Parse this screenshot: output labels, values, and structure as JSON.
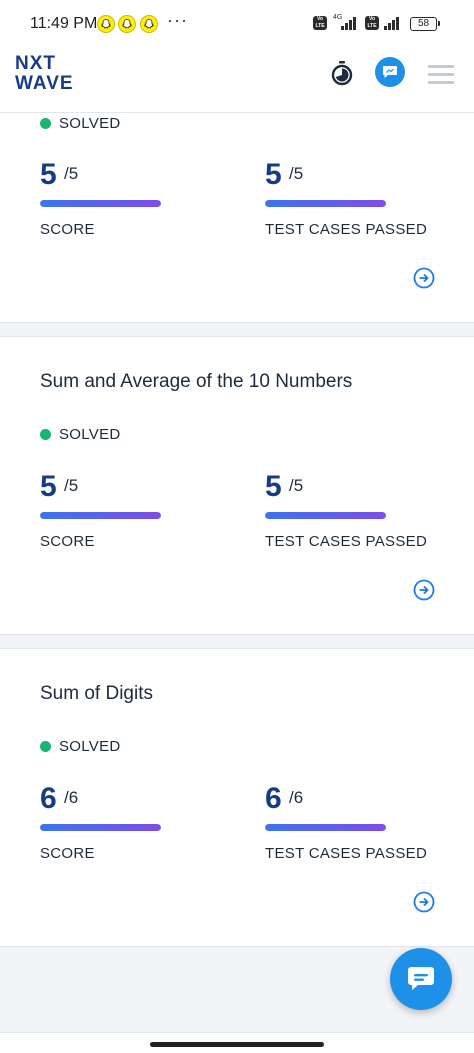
{
  "status_bar": {
    "time": "11:49 PM",
    "more": "···",
    "network": "4G",
    "volte": "Vo LTE",
    "battery": "58"
  },
  "header": {
    "logo_top": "NXT",
    "logo_bottom": "WAVE",
    "icons": [
      "timer-icon",
      "chat-icon",
      "menu-icon"
    ]
  },
  "cards": [
    {
      "title": "",
      "status": "SOLVED",
      "score": {
        "value": "5",
        "total": "/5",
        "label": "SCORE",
        "fraction": 1.0
      },
      "tests": {
        "value": "5",
        "total": "/5",
        "label": "TEST CASES PASSED",
        "fraction": 1.0
      }
    },
    {
      "title": "Sum and Average of the 10 Numbers",
      "status": "SOLVED",
      "score": {
        "value": "5",
        "total": "/5",
        "label": "SCORE",
        "fraction": 1.0
      },
      "tests": {
        "value": "5",
        "total": "/5",
        "label": "TEST CASES PASSED",
        "fraction": 1.0
      }
    },
    {
      "title": "Sum of Digits",
      "status": "SOLVED",
      "score": {
        "value": "6",
        "total": "/6",
        "label": "SCORE",
        "fraction": 1.0
      },
      "tests": {
        "value": "6",
        "total": "/6",
        "label": "TEST CASES PASSED",
        "fraction": 1.0
      }
    }
  ],
  "colors": {
    "brand": "#183b88",
    "accent": "#1e90e8",
    "solved": "#1ab373",
    "progress_start": "#3d74f0",
    "progress_end": "#7c4ee8"
  }
}
